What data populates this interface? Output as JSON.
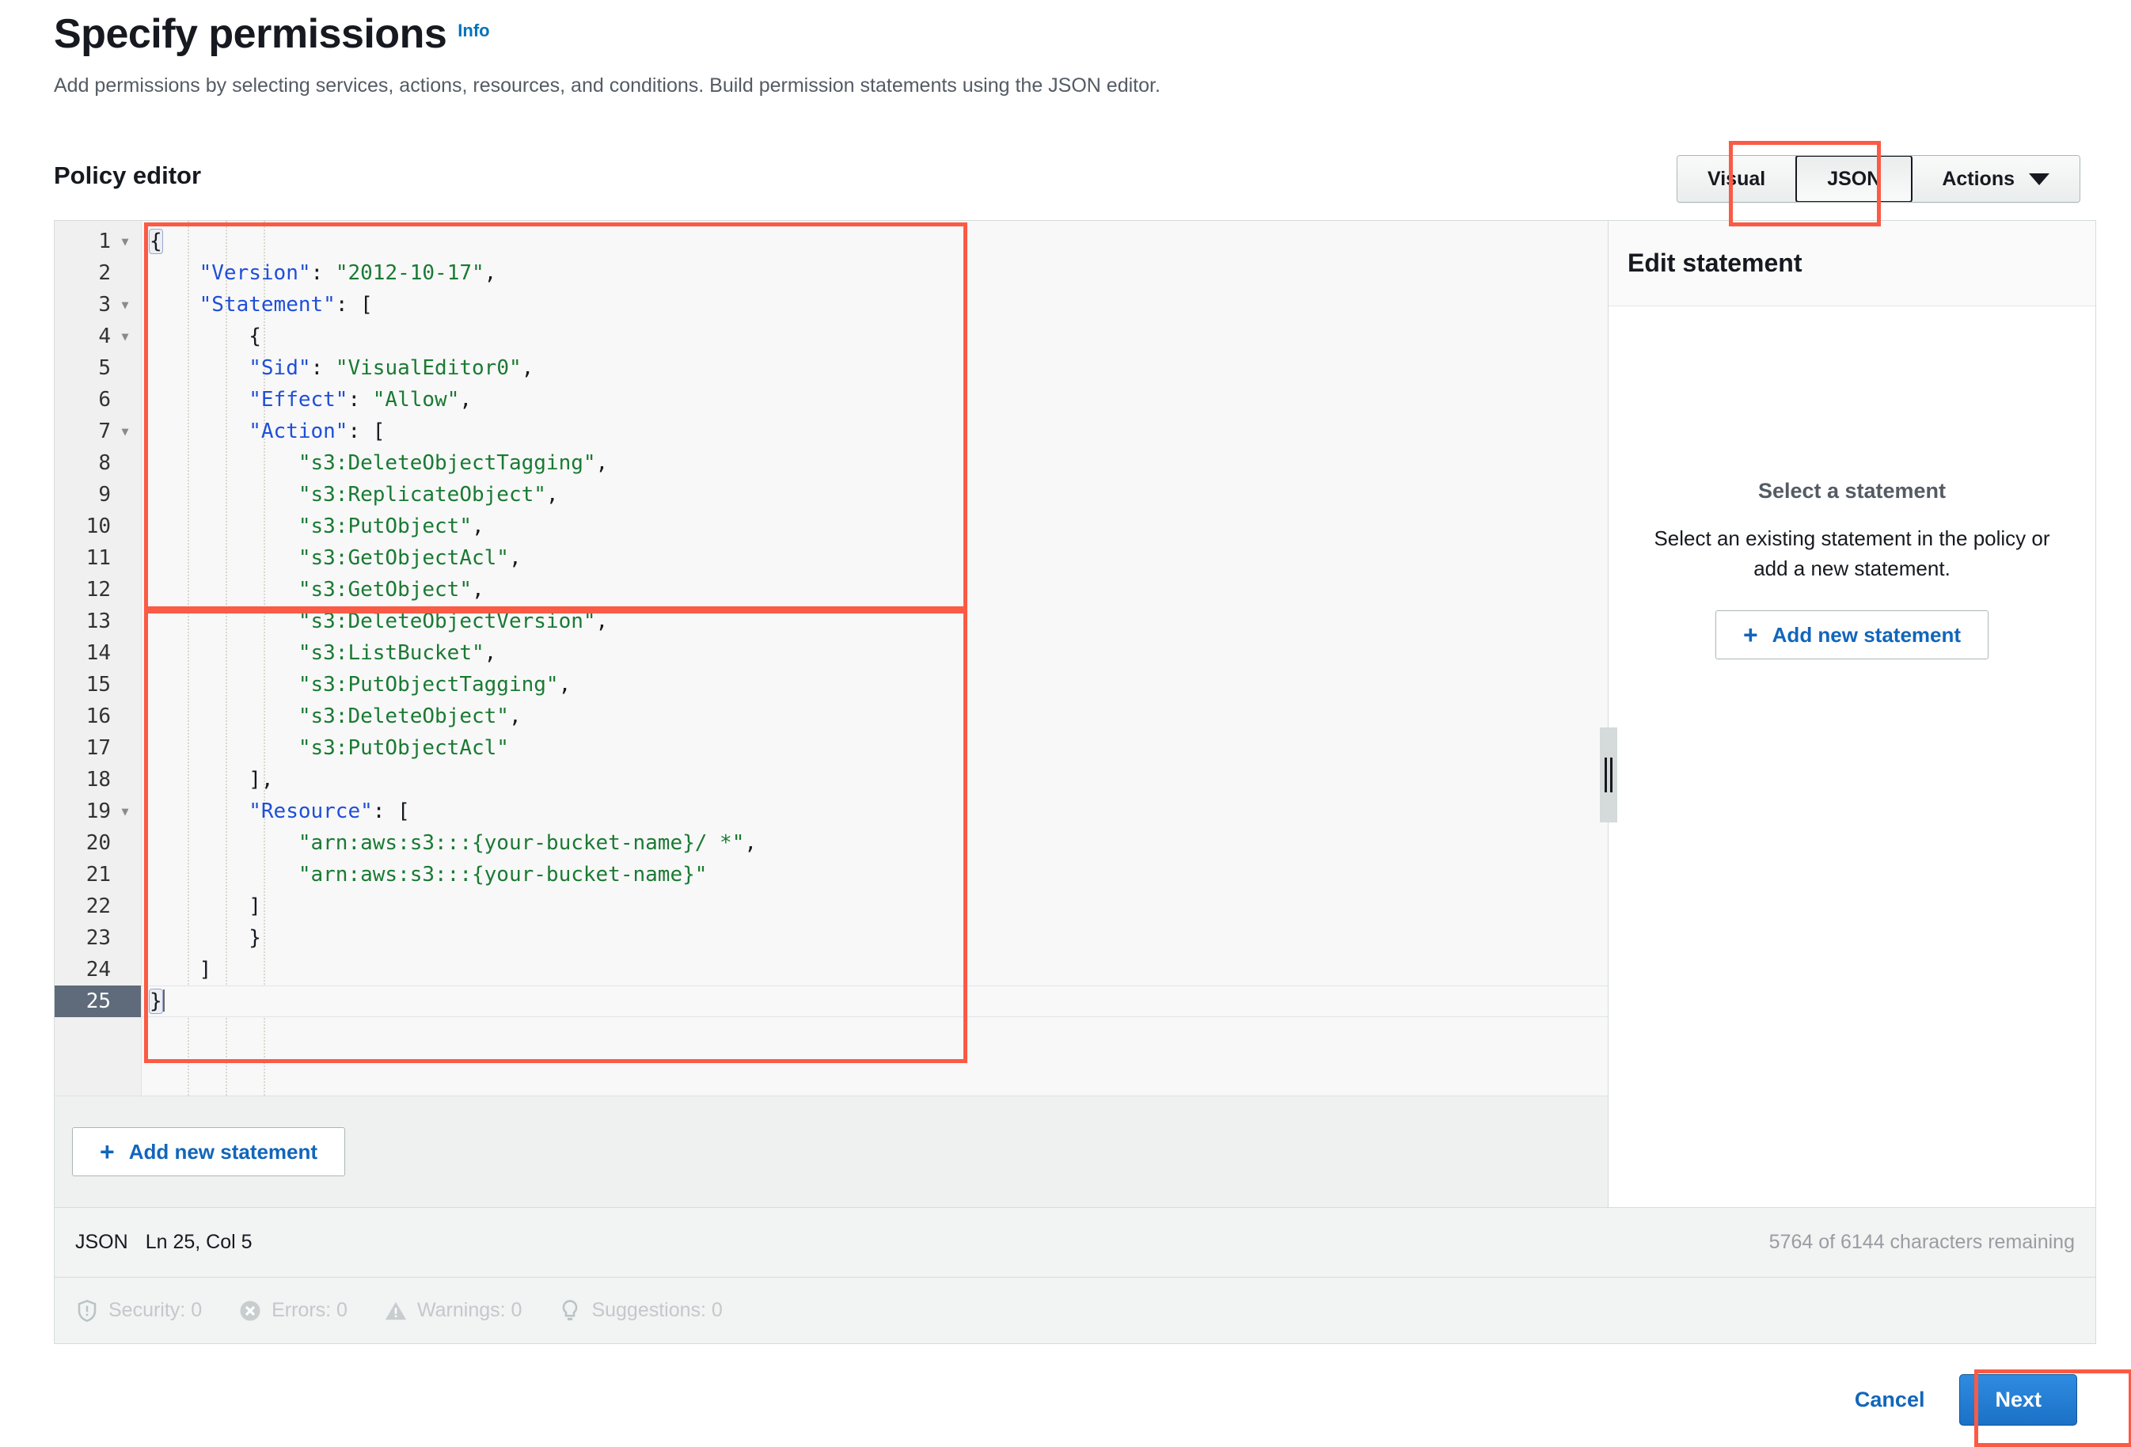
{
  "page": {
    "title": "Specify permissions",
    "info_link": "Info",
    "subtitle": "Add permissions by selecting services, actions, resources, and conditions. Build permission statements using the JSON editor."
  },
  "section": {
    "title": "Policy editor"
  },
  "toolbar": {
    "visual_label": "Visual",
    "json_label": "JSON",
    "actions_label": "Actions",
    "caret_icon": "chevron-down-icon",
    "active_tab": "JSON"
  },
  "editor": {
    "active_line": 25,
    "lines": [
      {
        "n": 1,
        "fold": true,
        "indent": 0,
        "tokens": [
          {
            "t": "punct",
            "v": "{"
          }
        ],
        "brace_hl": true
      },
      {
        "n": 2,
        "fold": false,
        "indent": 1,
        "tokens": [
          {
            "t": "key",
            "v": "\"Version\""
          },
          {
            "t": "punct",
            "v": ": "
          },
          {
            "t": "str",
            "v": "\"2012-10-17\""
          },
          {
            "t": "punct",
            "v": ","
          }
        ]
      },
      {
        "n": 3,
        "fold": true,
        "indent": 1,
        "tokens": [
          {
            "t": "key",
            "v": "\"Statement\""
          },
          {
            "t": "punct",
            "v": ": ["
          }
        ]
      },
      {
        "n": 4,
        "fold": true,
        "indent": 2,
        "tokens": [
          {
            "t": "punct",
            "v": "{"
          }
        ]
      },
      {
        "n": 5,
        "fold": false,
        "indent": 2,
        "tokens": [
          {
            "t": "key",
            "v": "\"Sid\""
          },
          {
            "t": "punct",
            "v": ": "
          },
          {
            "t": "str",
            "v": "\"VisualEditor0\""
          },
          {
            "t": "punct",
            "v": ","
          }
        ]
      },
      {
        "n": 6,
        "fold": false,
        "indent": 2,
        "tokens": [
          {
            "t": "key",
            "v": "\"Effect\""
          },
          {
            "t": "punct",
            "v": ": "
          },
          {
            "t": "str",
            "v": "\"Allow\""
          },
          {
            "t": "punct",
            "v": ","
          }
        ]
      },
      {
        "n": 7,
        "fold": true,
        "indent": 2,
        "tokens": [
          {
            "t": "key",
            "v": "\"Action\""
          },
          {
            "t": "punct",
            "v": ": ["
          }
        ]
      },
      {
        "n": 8,
        "fold": false,
        "indent": 3,
        "tokens": [
          {
            "t": "str",
            "v": "\"s3:DeleteObjectTagging\""
          },
          {
            "t": "punct",
            "v": ","
          }
        ]
      },
      {
        "n": 9,
        "fold": false,
        "indent": 3,
        "tokens": [
          {
            "t": "str",
            "v": "\"s3:ReplicateObject\""
          },
          {
            "t": "punct",
            "v": ","
          }
        ]
      },
      {
        "n": 10,
        "fold": false,
        "indent": 3,
        "tokens": [
          {
            "t": "str",
            "v": "\"s3:PutObject\""
          },
          {
            "t": "punct",
            "v": ","
          }
        ]
      },
      {
        "n": 11,
        "fold": false,
        "indent": 3,
        "tokens": [
          {
            "t": "str",
            "v": "\"s3:GetObjectAcl\""
          },
          {
            "t": "punct",
            "v": ","
          }
        ]
      },
      {
        "n": 12,
        "fold": false,
        "indent": 3,
        "tokens": [
          {
            "t": "str",
            "v": "\"s3:GetObject\""
          },
          {
            "t": "punct",
            "v": ","
          }
        ]
      },
      {
        "n": 13,
        "fold": false,
        "indent": 3,
        "tokens": [
          {
            "t": "str",
            "v": "\"s3:DeleteObjectVersion\""
          },
          {
            "t": "punct",
            "v": ","
          }
        ]
      },
      {
        "n": 14,
        "fold": false,
        "indent": 3,
        "tokens": [
          {
            "t": "str",
            "v": "\"s3:ListBucket\""
          },
          {
            "t": "punct",
            "v": ","
          }
        ]
      },
      {
        "n": 15,
        "fold": false,
        "indent": 3,
        "tokens": [
          {
            "t": "str",
            "v": "\"s3:PutObjectTagging\""
          },
          {
            "t": "punct",
            "v": ","
          }
        ]
      },
      {
        "n": 16,
        "fold": false,
        "indent": 3,
        "tokens": [
          {
            "t": "str",
            "v": "\"s3:DeleteObject\""
          },
          {
            "t": "punct",
            "v": ","
          }
        ]
      },
      {
        "n": 17,
        "fold": false,
        "indent": 3,
        "tokens": [
          {
            "t": "str",
            "v": "\"s3:PutObjectAcl\""
          }
        ]
      },
      {
        "n": 18,
        "fold": false,
        "indent": 2,
        "tokens": [
          {
            "t": "punct",
            "v": "],"
          }
        ]
      },
      {
        "n": 19,
        "fold": true,
        "indent": 2,
        "tokens": [
          {
            "t": "key",
            "v": "\"Resource\""
          },
          {
            "t": "punct",
            "v": ": ["
          }
        ]
      },
      {
        "n": 20,
        "fold": false,
        "indent": 3,
        "tokens": [
          {
            "t": "str",
            "v": "\"arn:aws:s3:::{your-bucket-name}/ *\""
          },
          {
            "t": "punct",
            "v": ","
          }
        ]
      },
      {
        "n": 21,
        "fold": false,
        "indent": 3,
        "tokens": [
          {
            "t": "str",
            "v": "\"arn:aws:s3:::{your-bucket-name}\""
          }
        ]
      },
      {
        "n": 22,
        "fold": false,
        "indent": 2,
        "tokens": [
          {
            "t": "punct",
            "v": "]"
          }
        ]
      },
      {
        "n": 23,
        "fold": false,
        "indent": 2,
        "tokens": [
          {
            "t": "punct",
            "v": "}"
          }
        ]
      },
      {
        "n": 24,
        "fold": false,
        "indent": 1,
        "tokens": [
          {
            "t": "punct",
            "v": "]"
          }
        ]
      },
      {
        "n": 25,
        "fold": false,
        "indent": 0,
        "tokens": [
          {
            "t": "punct",
            "v": "}"
          }
        ],
        "brace_hl": true,
        "caret": true
      }
    ],
    "add_statement_label": "Add new statement",
    "add_statement_icon": "plus-icon"
  },
  "right_panel": {
    "header": "Edit statement",
    "empty_title": "Select a statement",
    "empty_description": "Select an existing statement in the policy or add a new statement.",
    "add_statement_label": "Add new statement",
    "add_statement_icon": "plus-icon",
    "splitter_icon": "resize-handle-icon"
  },
  "status_bar": {
    "language": "JSON",
    "cursor": "Ln 25, Col 5",
    "characters": "5764 of 6144 characters remaining"
  },
  "findings": [
    {
      "icon": "shield-icon",
      "label": "Security: 0"
    },
    {
      "icon": "error-icon",
      "label": "Errors: 0"
    },
    {
      "icon": "warning-icon",
      "label": "Warnings: 0"
    },
    {
      "icon": "lightbulb-icon",
      "label": "Suggestions: 0"
    }
  ],
  "footer": {
    "cancel_label": "Cancel",
    "next_label": "Next"
  },
  "colors": {
    "accent_blue": "#1166bb",
    "primary_button": "#1b71c6",
    "annotation_red": "#fb5a45",
    "json_key": "#1f4fd8",
    "json_string": "#1a7a33"
  }
}
